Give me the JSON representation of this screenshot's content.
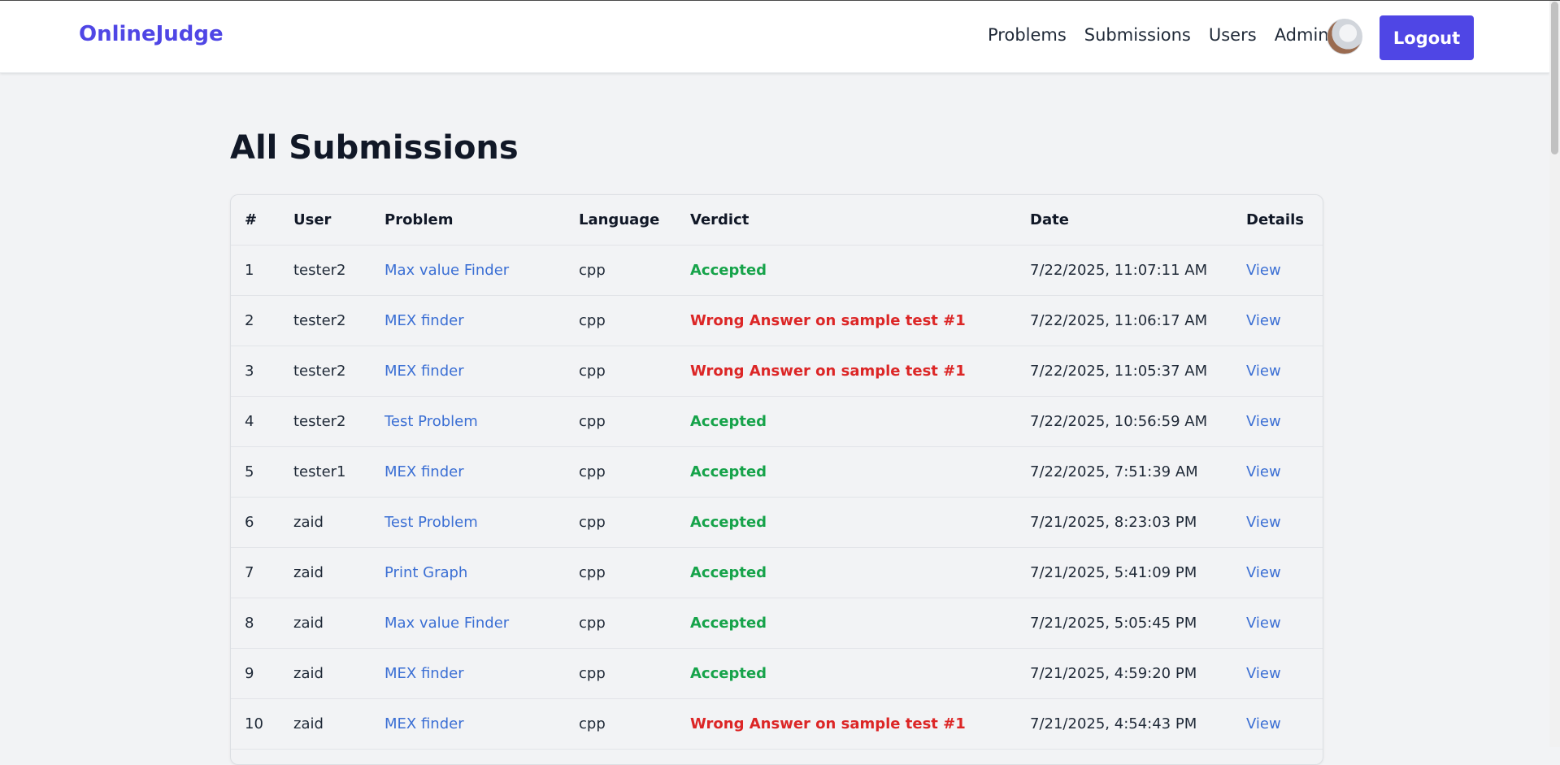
{
  "navbar": {
    "brand": "OnlineJudge",
    "links": [
      "Problems",
      "Submissions",
      "Users",
      "Admin"
    ],
    "logout_label": "Logout"
  },
  "page": {
    "title": "All Submissions"
  },
  "table": {
    "headers": [
      "#",
      "User",
      "Problem",
      "Language",
      "Verdict",
      "Date",
      "Details"
    ],
    "rows": [
      {
        "num": "1",
        "user": "tester2",
        "problem": "Max value Finder",
        "language": "cpp",
        "verdict": "Accepted",
        "date": "7/22/2025, 11:07:11 AM",
        "details": "View"
      },
      {
        "num": "2",
        "user": "tester2",
        "problem": "MEX finder",
        "language": "cpp",
        "verdict": "Wrong Answer on sample test #1",
        "date": "7/22/2025, 11:06:17 AM",
        "details": "View"
      },
      {
        "num": "3",
        "user": "tester2",
        "problem": "MEX finder",
        "language": "cpp",
        "verdict": "Wrong Answer on sample test #1",
        "date": "7/22/2025, 11:05:37 AM",
        "details": "View"
      },
      {
        "num": "4",
        "user": "tester2",
        "problem": "Test Problem",
        "language": "cpp",
        "verdict": "Accepted",
        "date": "7/22/2025, 10:56:59 AM",
        "details": "View"
      },
      {
        "num": "5",
        "user": "tester1",
        "problem": "MEX finder",
        "language": "cpp",
        "verdict": "Accepted",
        "date": "7/22/2025, 7:51:39 AM",
        "details": "View"
      },
      {
        "num": "6",
        "user": "zaid",
        "problem": "Test Problem",
        "language": "cpp",
        "verdict": "Accepted",
        "date": "7/21/2025, 8:23:03 PM",
        "details": "View"
      },
      {
        "num": "7",
        "user": "zaid",
        "problem": "Print Graph",
        "language": "cpp",
        "verdict": "Accepted",
        "date": "7/21/2025, 5:41:09 PM",
        "details": "View"
      },
      {
        "num": "8",
        "user": "zaid",
        "problem": "Max value Finder",
        "language": "cpp",
        "verdict": "Accepted",
        "date": "7/21/2025, 5:05:45 PM",
        "details": "View"
      },
      {
        "num": "9",
        "user": "zaid",
        "problem": "MEX finder",
        "language": "cpp",
        "verdict": "Accepted",
        "date": "7/21/2025, 4:59:20 PM",
        "details": "View"
      },
      {
        "num": "10",
        "user": "zaid",
        "problem": "MEX finder",
        "language": "cpp",
        "verdict": "Wrong Answer on sample test #1",
        "date": "7/21/2025, 4:54:43 PM",
        "details": "View"
      }
    ]
  },
  "colors": {
    "brand": "#4f46e5",
    "link": "#3b6fd4",
    "accepted": "#16a34a",
    "wrong_answer": "#dc2626"
  }
}
